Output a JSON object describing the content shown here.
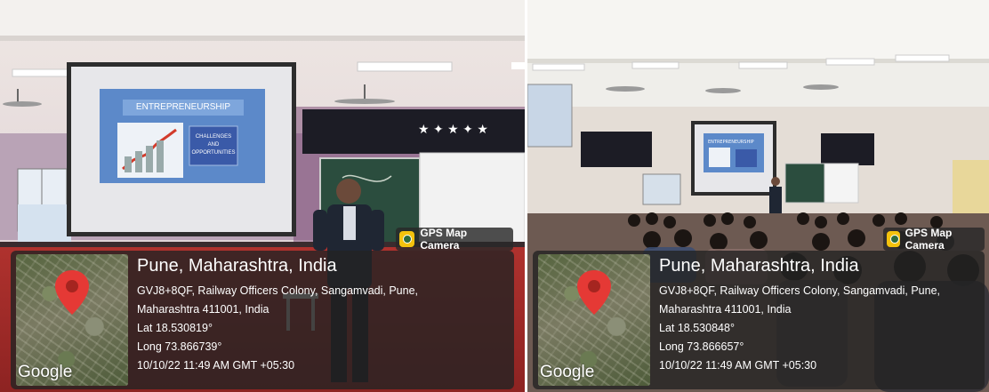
{
  "photos": [
    {
      "gps_badge": "GPS Map Camera",
      "slide_title": "ENTREPRENEURSHIP",
      "slide_subtitle": "CHALLENGES AND OPPORTUNITIES",
      "location": "Pune, Maharashtra, India",
      "address_line1": "GVJ8+8QF, Railway Officers Colony, Sangamvadi, Pune,",
      "address_line2": "Maharashtra 411001, India",
      "lat": "Lat 18.530819°",
      "long": "Long 73.866739°",
      "datetime": "10/10/22 11:49 AM GMT +05:30",
      "map_logo": "Google"
    },
    {
      "gps_badge": "GPS Map Camera",
      "slide_title": "ENTREPRENEURSHIP",
      "location": "Pune, Maharashtra, India",
      "address_line1": "GVJ8+8QF, Railway Officers Colony, Sangamvadi, Pune,",
      "address_line2": "Maharashtra 411001, India",
      "lat": "Lat 18.530848°",
      "long": "Long 73.866657°",
      "datetime": "10/10/22 11:49 AM GMT +05:30",
      "map_logo": "Google"
    }
  ],
  "colors": {
    "overlay": "#232323",
    "pin": "#e53935",
    "badge_icon": "#f4c20d"
  }
}
